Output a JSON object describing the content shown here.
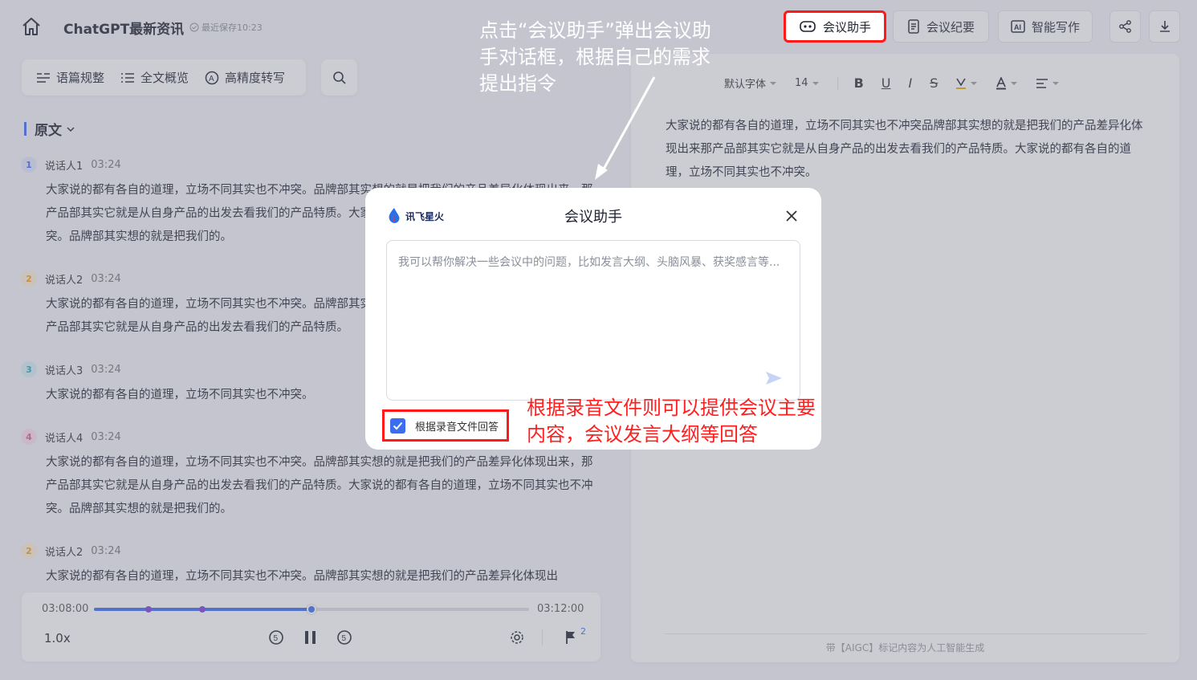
{
  "header": {
    "title": "ChatGPT最新资讯",
    "save_status": "最近保存10:23",
    "buttons": {
      "meeting_assistant": "会议助手",
      "meeting_minutes": "会议纪要",
      "smart_writing": "智能写作"
    }
  },
  "left_tools": {
    "items": [
      "语篇规整",
      "全文概览",
      "高精度转写"
    ]
  },
  "transcript": {
    "section_title": "原文",
    "entries": [
      {
        "badge": "1",
        "speaker": "说话人1",
        "time": "03:24",
        "text": "大家说的都有各自的道理，立场不同其实也不冲突。品牌部其实想的就是把我们的产品差异化体现出来，那产品部其实它就是从自身产品的出发去看我们的产品特质。大家说的都有各自的道理，立场不同其实也不冲突。品牌部其实想的就是把我们的。"
      },
      {
        "badge": "2",
        "speaker": "说话人2",
        "time": "03:24",
        "text": "大家说的都有各自的道理，立场不同其实也不冲突。品牌部其实想的就是把我们的产品差异化体现出来，那产品部其实它就是从自身产品的出发去看我们的产品特质。"
      },
      {
        "badge": "3",
        "speaker": "说话人3",
        "time": "03:24",
        "text": "大家说的都有各自的道理，立场不同其实也不冲突。"
      },
      {
        "badge": "4",
        "speaker": "说话人4",
        "time": "03:24",
        "text": "大家说的都有各自的道理，立场不同其实也不冲突。品牌部其实想的就是把我们的产品差异化体现出来，那产品部其实它就是从自身产品的出发去看我们的产品特质。大家说的都有各自的道理，立场不同其实也不冲突。品牌部其实想的就是把我们的。"
      },
      {
        "badge": "2",
        "speaker": "说话人2",
        "time": "03:24",
        "text": "大家说的都有各自的道理，立场不同其实也不冲突。品牌部其实想的就是把我们的产品差异化体现出"
      }
    ]
  },
  "player": {
    "current": "03:08:00",
    "total": "03:12:00",
    "speed": "1.0x",
    "progress": 0.5,
    "flag_count": "2"
  },
  "editor": {
    "font": "默认字体",
    "font_size": "14",
    "content": "大家说的都有各自的道理，立场不同其实也不冲突品牌部其实想的就是把我们的产品差异化体现出来那产品部其实它就是从自身产品的出发去看我们的产品特质。大家说的都有各自的道理，立场不同其实也不冲突。",
    "footer": "带【AIGC】标记内容为人工智能生成"
  },
  "modal": {
    "logo_text": "讯飞星火",
    "title": "会议助手",
    "placeholder": "我可以帮你解决一些会议中的问题，比如发言大纲、头脑风暴、获奖感言等...",
    "checkbox_label": "根据录音文件回答",
    "checkbox_checked": true
  },
  "annotations": {
    "top": "点击“会议助手”弹出会议助手对话框，根据自己的需求提出指令",
    "bottom": "根据录音文件则可以提供会议主要内容，会议发言大纲等回答"
  },
  "colors": {
    "accent": "#3a6df0",
    "highlight": "#ff1a1a",
    "badge1": "#3a6df0",
    "badge2": "#f0a020",
    "badge3": "#2aa5b8",
    "badge4": "#e05a9a"
  }
}
